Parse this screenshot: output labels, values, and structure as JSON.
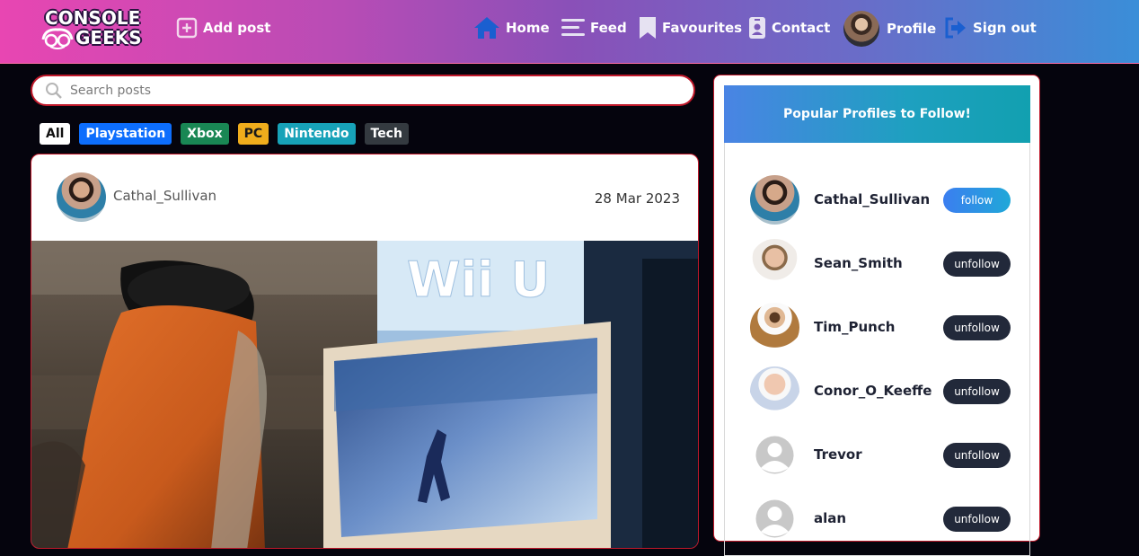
{
  "brand": {
    "logo_line1": "CONSOLE",
    "logo_line2": "GEEKS"
  },
  "navbar": {
    "add_post": "Add post",
    "home": "Home",
    "feed": "Feed",
    "favourites": "Favourites",
    "contact": "Contact",
    "profile": "Profile",
    "sign_out": "Sign out",
    "icons": {
      "add_post": "plus-square-icon",
      "home": "home-icon",
      "feed": "menu-lines-icon",
      "favourites": "bookmark-icon",
      "contact": "id-badge-icon",
      "sign_out": "sign-out-icon"
    }
  },
  "search": {
    "placeholder": "Search posts",
    "value": ""
  },
  "filters": [
    {
      "label": "All",
      "color": "#ffffff",
      "text_color": "#111111"
    },
    {
      "label": "Playstation",
      "color": "#0d6efd",
      "text_color": "#ffffff"
    },
    {
      "label": "Xbox",
      "color": "#198754",
      "text_color": "#ffffff"
    },
    {
      "label": "PC",
      "color": "#f0ad1c",
      "text_color": "#1a1a1a"
    },
    {
      "label": "Nintendo",
      "color": "#17a2b8",
      "text_color": "#ffffff"
    },
    {
      "label": "Tech",
      "color": "#343a40",
      "text_color": "#ffffff"
    }
  ],
  "post": {
    "author": "Cathal_Sullivan",
    "date": "28 Mar 2023",
    "image_sign_text": "Wii U"
  },
  "sidebar": {
    "title": "Popular Profiles to Follow!",
    "profiles": [
      {
        "name": "Cathal_Sullivan",
        "action": "follow"
      },
      {
        "name": "Sean_Smith",
        "action": "unfollow"
      },
      {
        "name": "Tim_Punch",
        "action": "unfollow"
      },
      {
        "name": "Conor_O_Keeffe",
        "action": "unfollow"
      },
      {
        "name": "Trevor",
        "action": "unfollow"
      },
      {
        "name": "alan",
        "action": "unfollow"
      }
    ]
  },
  "colors": {
    "accent_border": "#c0182a",
    "follow_button": "#3b7ef0",
    "unfollow_button": "#22293a"
  }
}
